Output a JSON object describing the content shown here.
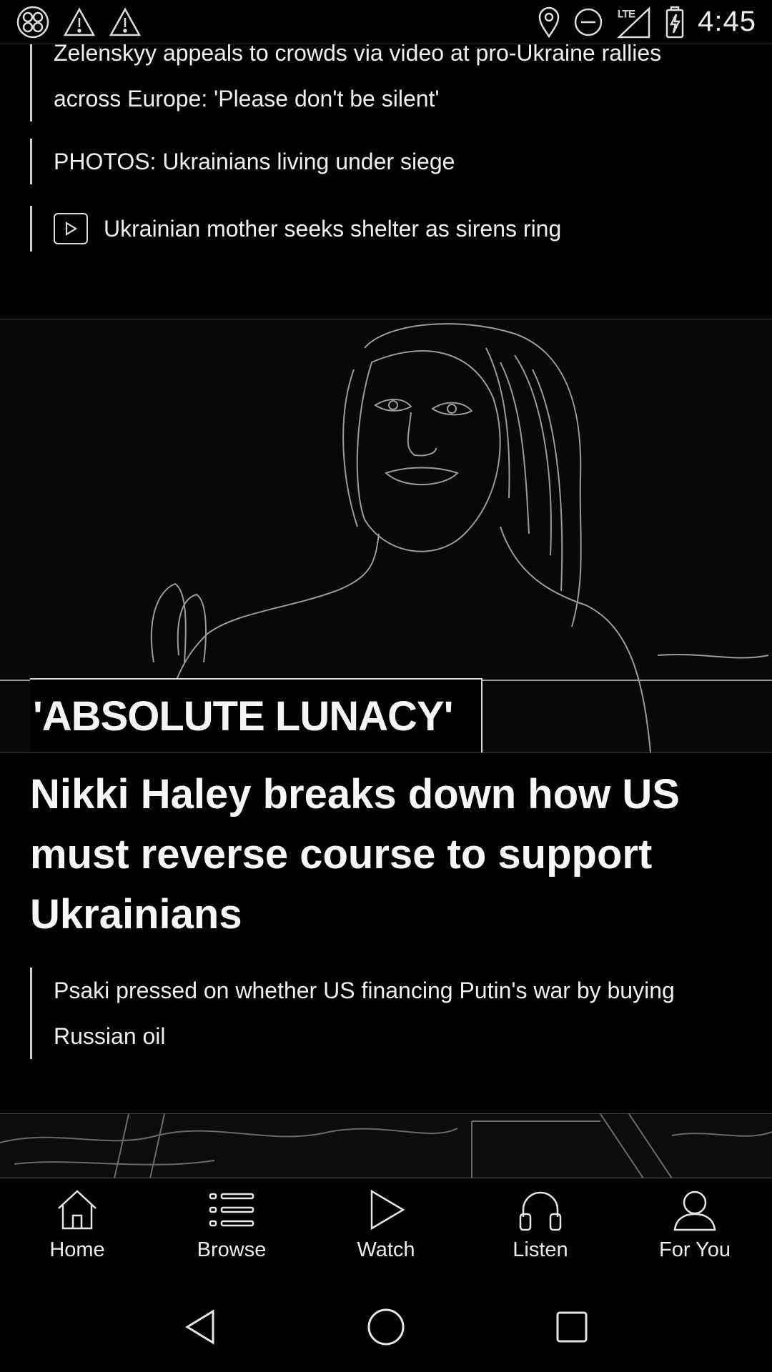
{
  "status_bar": {
    "time": "4:45",
    "network": "LTE",
    "left_icons": [
      "app-launcher-icon",
      "alert-icon",
      "alert-icon"
    ],
    "right_icons": [
      "location-icon",
      "do-not-disturb-icon",
      "lte-signal-icon",
      "battery-charging-icon"
    ]
  },
  "feed": {
    "related_1": "Zelenskyy appeals to crowds via video at pro-Ukraine rallies across Europe: 'Please don't be silent'",
    "related_2": "PHOTOS: Ukrainians living under siege",
    "related_3": "Ukrainian mother seeks shelter as sirens ring",
    "hero_kicker": "'ABSOLUTE LUNACY'",
    "hero_headline": "Nikki Haley breaks down how US must reverse course to support Ukrainians",
    "related_4": "Psaki pressed on whether US financing Putin's war by buying Russian oil"
  },
  "bottom_nav": {
    "items": [
      {
        "label": "Home",
        "icon": "home-icon"
      },
      {
        "label": "Browse",
        "icon": "list-icon"
      },
      {
        "label": "Watch",
        "icon": "play-icon"
      },
      {
        "label": "Listen",
        "icon": "headphones-icon"
      },
      {
        "label": "For You",
        "icon": "person-icon"
      }
    ]
  },
  "system_nav": [
    "back-icon",
    "home-circle-icon",
    "recents-icon"
  ]
}
